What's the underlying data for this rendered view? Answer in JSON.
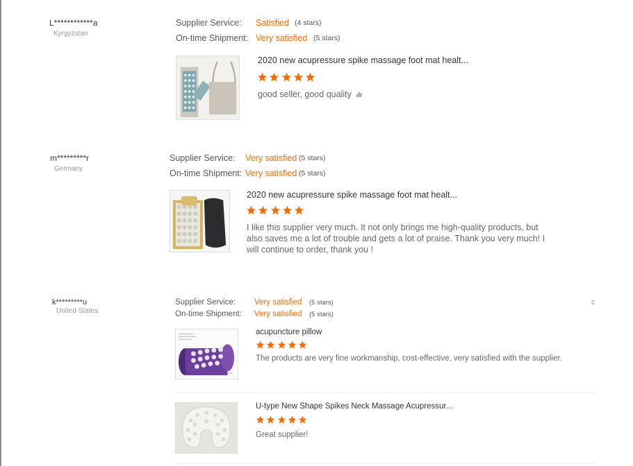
{
  "labels": {
    "supplier_service": "Supplier Service:",
    "on_time_shipment": "On-time Shipment:"
  },
  "colors": {
    "accent": "#ff6a00",
    "star": "#ff6a00"
  },
  "reviews": [
    {
      "buyer": "L************a",
      "country": "Kyrgyzstan",
      "supplier_service": {
        "value": "Satisfied",
        "stars": "(4 stars)"
      },
      "on_time_shipment": {
        "value": "Very satisfied",
        "stars": "(5 stars)"
      },
      "products": [
        {
          "image_icon": "acupressure-mat-and-bag-thumbnail",
          "title": "2020 new acupressure spike massage foot mat healt...",
          "rating": 5,
          "comment": "good seller, good quality",
          "comment_icon": "thumbs-up-icon"
        }
      ]
    },
    {
      "buyer": "m*********r",
      "country": "Germany",
      "supplier_service": {
        "value": "Very satisfied",
        "stars": "(5 stars)"
      },
      "on_time_shipment": {
        "value": "Very satisfied",
        "stars": "(5 stars)"
      },
      "products": [
        {
          "image_icon": "acupressure-mat-gold-thumbnail",
          "title": "2020 new acupressure spike massage foot mat healt...",
          "rating": 5,
          "comment": "I like this supplier very much. It not only brings me high-quality products, but also saves me a lot of trouble and gets a lot of praise. Thank you very much! I will continue to order, thank you !"
        }
      ]
    },
    {
      "buyer": "k*********u",
      "country": "United States",
      "supplier_service": {
        "value": "Very satisfied",
        "stars": "(5 stars)"
      },
      "on_time_shipment": {
        "value": "Very satisfied",
        "stars": "(5 stars)"
      },
      "corner_mark": "c",
      "products": [
        {
          "image_icon": "acupuncture-pillow-thumbnail",
          "title": "acupuncture pillow",
          "rating": 5,
          "comment": "The products are very fine workmanship, cost-effective, very satisfied with the supplier."
        },
        {
          "image_icon": "neck-pillow-thumbnail",
          "title": "U-type New Shape Spikes Neck Massage Acupressur...",
          "rating": 5,
          "comment": "Great supplier!"
        }
      ]
    }
  ]
}
